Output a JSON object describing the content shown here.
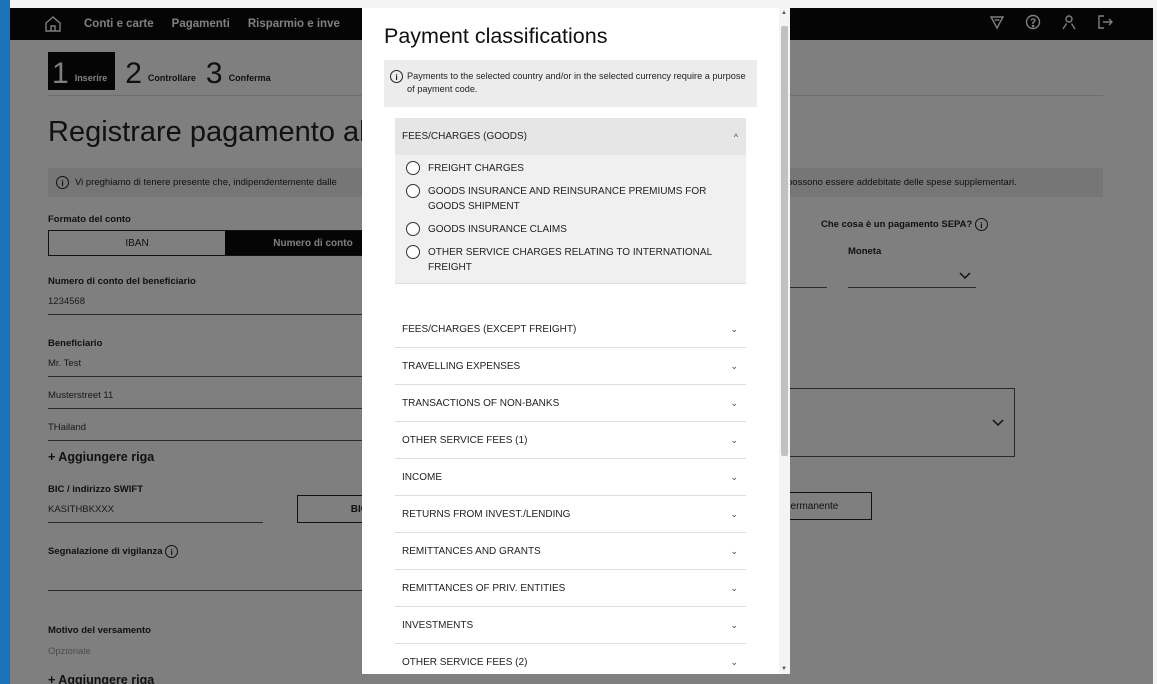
{
  "nav": {
    "items": [
      "Conti e carte",
      "Pagamenti",
      "Risparmio e inve"
    ]
  },
  "steps": [
    {
      "num": "1",
      "label": "Inserire"
    },
    {
      "num": "2",
      "label": "Controllare"
    },
    {
      "num": "3",
      "label": "Conferma"
    }
  ],
  "page": {
    "title": "Registrare pagamento all",
    "info_left": "Vi preghiamo di tenere presente che, indipendentemente dalle",
    "info_right": "possono essere addebitate delle spese supplementari.",
    "account_format_label": "Formato del conto",
    "account_format_options": [
      "IBAN",
      "Numero di conto"
    ],
    "sepa_question": "Che cosa è un pagamento SEPA?",
    "currency_label": "Moneta",
    "beneficiary_account_label": "Numero di conto del beneficiario",
    "beneficiary_account_value": "1234568",
    "beneficiary_label": "Beneficiario",
    "beneficiary_lines": [
      "Mr. Test",
      "Musterstreet 11",
      "THailand"
    ],
    "add_line": "+ Aggiungere riga",
    "bic_label": "BIC / indirizzo SWIFT",
    "bic_value": "KASITHBKXXX",
    "bic_button": "BIC",
    "supervisory_label": "Segnalazione di vigilanza",
    "reason_label": "Motivo del versamento",
    "reason_placeholder": "Opzionale",
    "add_line_2": "+ Aggiungere riga",
    "permanent_button": "permanente"
  },
  "modal": {
    "title": "Payment classifications",
    "info": "Payments to the selected country and/or in the selected currency require a purpose of payment code.",
    "open_section": {
      "label": "FEES/CHARGES (GOODS)",
      "options": [
        "FREIGHT CHARGES",
        "GOODS INSURANCE AND REINSURANCE PREMIUMS FOR GOODS SHIPMENT",
        "GOODS INSURANCE CLAIMS",
        "OTHER SERVICE CHARGES RELATING TO INTERNATIONAL FREIGHT"
      ]
    },
    "sections": [
      "FEES/CHARGES (EXCEPT FREIGHT)",
      "TRAVELLING EXPENSES",
      "TRANSACTIONS OF NON-BANKS",
      "OTHER SERVICE FEES (1)",
      "INCOME",
      "RETURNS FROM INVEST./LENDING",
      "REMITTANCES AND GRANTS",
      "REMITTANCES OF PRIV. ENTITIES",
      "INVESTMENTS",
      "OTHER SERVICE FEES (2)"
    ]
  }
}
